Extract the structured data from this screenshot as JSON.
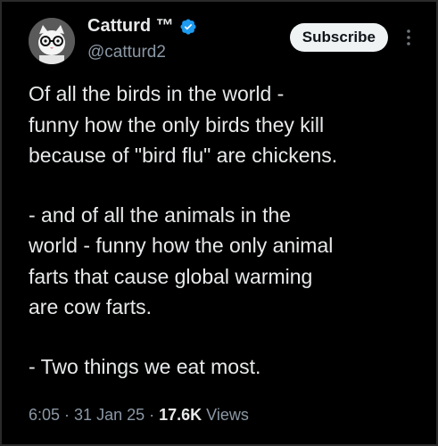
{
  "author": {
    "display_name": "Catturd ™",
    "handle": "@catturd2",
    "verified": true,
    "avatar_icon": "cat-avatar-icon"
  },
  "actions": {
    "subscribe_label": "Subscribe",
    "more_icon": "more-options-icon"
  },
  "tweet": {
    "paragraphs": [
      "Of all the birds in the world -\nfunny how the only birds they kill\nbecause of \"bird flu\" are chickens.",
      "- and of all the animals in the\nworld - funny how the only animal\nfarts that cause global warming\nare cow farts.",
      "- Two things we eat most."
    ]
  },
  "meta": {
    "time": "6:05",
    "sep1": " · ",
    "date": "31 Jan 25",
    "sep2": " · ",
    "views_count": "17.6K",
    "views_label": " Views"
  },
  "colors": {
    "background": "#000000",
    "text": "#e7e9ea",
    "secondary": "#8b98a5",
    "verified_blue": "#1d9bf0"
  }
}
